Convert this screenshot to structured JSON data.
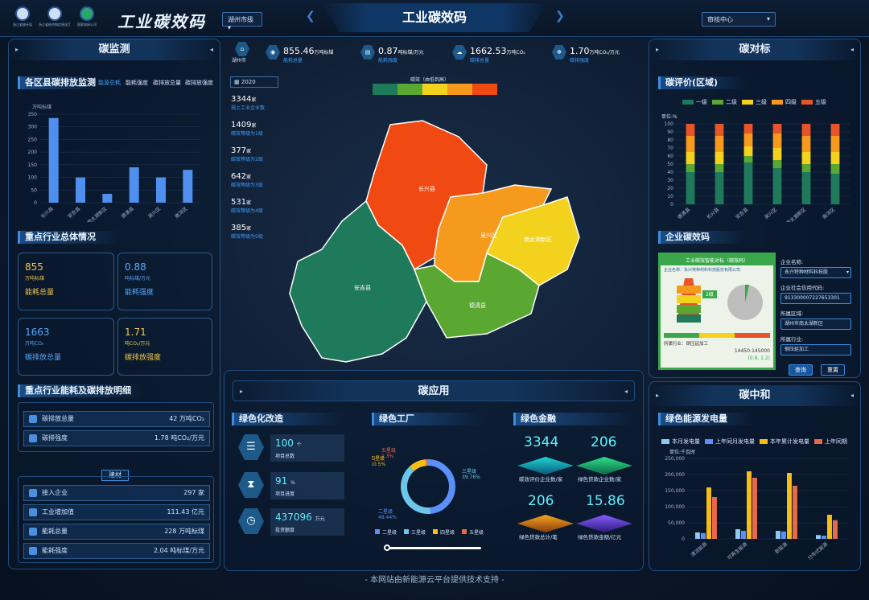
{
  "header": {
    "logos": [
      {
        "label": "浙江省统计局"
      },
      {
        "label": "浙江省经济和信息化厅"
      },
      {
        "label": "国家电网公司"
      }
    ],
    "brand": "工业碳效码",
    "region_select": "湖州市级",
    "center_title": "工业碳效码",
    "right_select": "审核中心"
  },
  "monitor": {
    "title": "碳监测",
    "district_section": "各区县碳排放监测",
    "tabs": [
      "能源总耗",
      "能耗强度",
      "碳排放总量",
      "碳排放强度"
    ],
    "unit": "万吨标煤",
    "chart_data": {
      "type": "bar",
      "categories": [
        "长兴县",
        "安吉县",
        "南太湖新区",
        "德清县",
        "吴兴区",
        "南浔区"
      ],
      "values": [
        335,
        100,
        35,
        140,
        100,
        130
      ],
      "ylabel": "万吨标煤",
      "ylim": [
        0,
        350
      ],
      "yticks": [
        0,
        50,
        100,
        150,
        200,
        250,
        300,
        350
      ]
    },
    "industry_section": "重点行业总体情况",
    "cards": [
      {
        "value": "855",
        "unit": "万吨标煤",
        "name": "能耗总量",
        "color": "#f2c94c"
      },
      {
        "value": "0.88",
        "unit": "吨标煤/万元",
        "name": "能耗强度",
        "color": "#5aa8ff"
      },
      {
        "value": "1663",
        "unit": "万吨CO₂",
        "name": "碳排放总量",
        "color": "#5aa8ff"
      },
      {
        "value": "1.71",
        "unit": "吨CO₂/万元",
        "name": "碳排放强度",
        "color": "#f2c94c"
      }
    ],
    "detail_section": "重点行业能耗及碳排放明细",
    "rows_top": [
      {
        "label": "碳排放总量",
        "value": "42 万吨CO₂"
      },
      {
        "label": "碳排强度",
        "value": "1.78 吨CO₂/万元"
      }
    ],
    "group_label": "建材",
    "rows_bottom": [
      {
        "label": "接入企业",
        "value": "297 家"
      },
      {
        "label": "工业增加值",
        "value": "111.43 亿元"
      },
      {
        "label": "能耗总量",
        "value": "228 万吨标煤"
      },
      {
        "label": "能耗强度",
        "value": "2.04 吨标煤/万元"
      }
    ]
  },
  "center": {
    "city": "湖州市",
    "top_stats": [
      {
        "value": "855.46",
        "unit": "万吨标煤",
        "label": "能耗总量"
      },
      {
        "value": "0.87",
        "unit": "吨标煤/万元",
        "label": "能耗强度"
      },
      {
        "value": "1662.53",
        "unit": "万吨CO₂",
        "label": "碳排总量"
      },
      {
        "value": "1.70",
        "unit": "万吨CO₂/万元",
        "label": "碳排强度"
      }
    ],
    "year": "2020",
    "legend_title": "碳效（由低到高）",
    "legend_colors": [
      "#1e7a5a",
      "#5aa832",
      "#f2d21c",
      "#f59a1c",
      "#f04a12"
    ],
    "stats": [
      {
        "value": "3344",
        "unit": "家",
        "label": "规上工业企业数"
      },
      {
        "value": "1409",
        "unit": "家",
        "label": "碳效等级为1级"
      },
      {
        "value": "377",
        "unit": "家",
        "label": "碳效等级为2级"
      },
      {
        "value": "642",
        "unit": "家",
        "label": "碳效等级为3级"
      },
      {
        "value": "531",
        "unit": "家",
        "label": "碳效等级为4级"
      },
      {
        "value": "385",
        "unit": "家",
        "label": "碳效等级为5级"
      }
    ],
    "map_regions": [
      {
        "name": "长兴县",
        "color": "#f04a12"
      },
      {
        "name": "吴兴区",
        "color": "#f59a1c"
      },
      {
        "name": "南太湖新区",
        "color": "#f2d21c"
      },
      {
        "name": "安吉县",
        "color": "#1e7a5a"
      },
      {
        "name": "德清县",
        "color": "#5aa832"
      }
    ]
  },
  "application": {
    "title": "碳应用",
    "green_transform": "绿色化改造",
    "green_factory": "绿色工厂",
    "green_finance": "绿色金融",
    "transform_items": [
      {
        "value": "100",
        "unit": "个",
        "label": "项目总数"
      },
      {
        "value": "91",
        "unit": "%",
        "label": "项目进度"
      },
      {
        "value": "437096",
        "unit": "万元",
        "label": "投资额度"
      }
    ],
    "donut": {
      "type": "pie",
      "labels": [
        "二星级",
        "三星级",
        "四星级",
        "五星级"
      ],
      "values": [
        48.44,
        39.76,
        10.5,
        1.3
      ],
      "display": [
        "48.44%",
        "39.76%",
        "10.5%",
        "1.3%"
      ],
      "colors": [
        "#5b8ff9",
        "#6bc6ea",
        "#f6bd16",
        "#e8684a"
      ]
    },
    "finance": [
      {
        "value": "3344",
        "label": "碳效评价企业数/家"
      },
      {
        "value": "206",
        "label": "绿色贷款企业数/家"
      },
      {
        "value": "206",
        "label": "绿色贷款总计/笔"
      },
      {
        "value": "15.86",
        "label": "绿色贷款金额/亿元"
      }
    ]
  },
  "benchmark": {
    "title": "碳对标",
    "rating_section": "碳评价(区域)",
    "levels": [
      "一级",
      "二级",
      "三级",
      "四级",
      "五级"
    ],
    "level_colors": [
      "#1e7a5a",
      "#5aa832",
      "#f2d21c",
      "#f59a1c",
      "#e8532a"
    ],
    "unit": "单位:%",
    "chart_data": {
      "type": "bar",
      "categories": [
        "德清县",
        "长兴县",
        "安吉县",
        "吴兴区",
        "南太湖新区",
        "南浔区"
      ],
      "series": [
        {
          "name": "一级",
          "values": [
            40,
            40,
            52,
            45,
            40,
            38
          ]
        },
        {
          "name": "二级",
          "values": [
            10,
            10,
            8,
            10,
            10,
            12
          ]
        },
        {
          "name": "三级",
          "values": [
            15,
            15,
            12,
            15,
            15,
            15
          ]
        },
        {
          "name": "四级",
          "values": [
            20,
            20,
            16,
            18,
            20,
            20
          ]
        },
        {
          "name": "五级",
          "values": [
            15,
            15,
            12,
            12,
            15,
            15
          ]
        }
      ],
      "ylim": [
        0,
        100
      ],
      "yticks": [
        0,
        10,
        20,
        30,
        40,
        50,
        60,
        70,
        80,
        90,
        100
      ]
    },
    "enterprise_section": "企业碳效码",
    "code_card_title": "工业碳效智能对标（碳效码）",
    "code_card_company": "企业名称：永兴特种材料科技股份有限公司",
    "code_card_level": "2级",
    "code_card_industry": "所属行业：钢压延加工",
    "code_card_range": "14450-145000",
    "code_card_ratio": "(0.8, 1.2)",
    "form": {
      "name_label": "企业名称:",
      "name_value": "永兴特种材料科技股",
      "credit_label": "企业社会信用代码:",
      "credit_value": "913300007227653301",
      "area_label": "所属区域:",
      "area_value": "湖州市南太湖新区",
      "industry_label": "所属行业:",
      "industry_value": "钢压延加工",
      "query": "查询",
      "reset": "重置"
    }
  },
  "neutral": {
    "title": "碳中和",
    "section": "绿色能源发电量",
    "legend": [
      {
        "name": "本月发电量",
        "color": "#8cc8f2"
      },
      {
        "name": "上年同月发电量",
        "color": "#5b8ff9"
      },
      {
        "name": "本年累计发电量",
        "color": "#f6bd16"
      },
      {
        "name": "上年同期",
        "color": "#e8684a"
      }
    ],
    "unit": "单位:千瓦时",
    "chart_data": {
      "type": "bar",
      "categories": [
        "清洁能源",
        "可再生能源",
        "新能源",
        "分布式能源"
      ],
      "series": [
        {
          "name": "本月发电量",
          "values": [
            20000,
            30000,
            25000,
            12000
          ]
        },
        {
          "name": "上年同月发电量",
          "values": [
            18000,
            25000,
            23000,
            10000
          ]
        },
        {
          "name": "本年累计发电量",
          "values": [
            160000,
            210000,
            205000,
            75000
          ]
        },
        {
          "name": "上年同期",
          "values": [
            130000,
            190000,
            165000,
            58000
          ]
        }
      ],
      "ylim": [
        0,
        250000
      ],
      "yticks": [
        "0",
        "50,000",
        "100,000",
        "150,000",
        "200,000",
        "250,000"
      ]
    }
  },
  "footer": "- 本网站由新能源云平台提供技术支持 -"
}
